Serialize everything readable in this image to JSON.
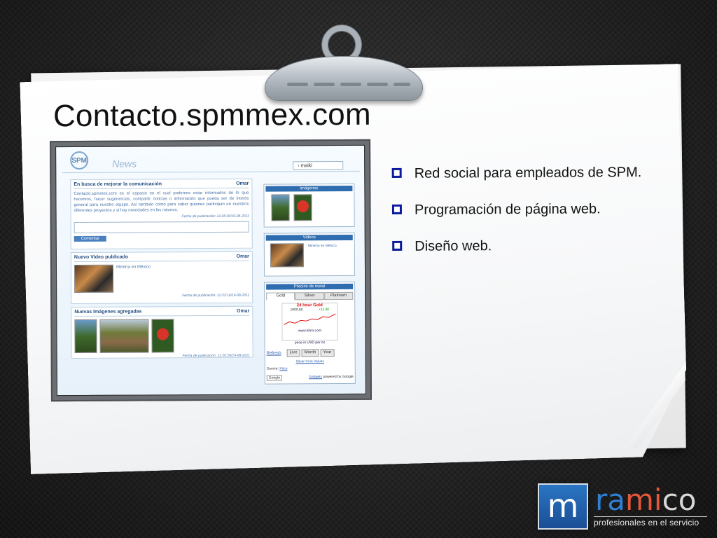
{
  "slide": {
    "title": "Contacto.spmmex.com"
  },
  "bullets": [
    "Red social para empleados de SPM.",
    "Programación de página web.",
    "Diseño web."
  ],
  "screenshot": {
    "logo": "SPM",
    "section_title": "News",
    "user": "maiki",
    "posts": [
      {
        "title": "En busca de mejorar la comunicación",
        "author": "Omar",
        "body": "Contacto.spmmex.com es el espacio en el cual podemos estar informados de lo que hacemos, hacer sugerencias, compartir noticias o información que pueda ser de interés general para nuestro equipo. Así también como para saber quienes participan en nuestros diferentes proyectos y si hay novedades en los mismos.",
        "date": "Fecha de publicación: 12:28:30/19-08-2011",
        "button": "Comentar"
      },
      {
        "title": "Nuevo Video publicado",
        "author": "Omar",
        "caption": "Minería en México",
        "date": "Fecha de publicación: 12:22:16/19-08-2011"
      },
      {
        "title": "Nuevas Imágenes agregadas",
        "author": "Omar",
        "date": "Fecha de publicación: 12:20:26/19-08-2011"
      }
    ],
    "sidebar": {
      "images_title": "Imágenes",
      "videos_title": "Videos",
      "video_caption": "Minería en México",
      "metals_title": "Precios de metal",
      "tabs": [
        "Gold",
        "Silver",
        "Platinum"
      ],
      "chart_title": "24 hour Gold",
      "chart_price": "1909.60",
      "chart_change": "+11.40",
      "chart_site": "www.kitco.com",
      "chart_unit": "price in USD per oz",
      "refresh": "Refresh",
      "range_buttons": [
        "Live",
        "Month",
        "Year"
      ],
      "coin_link": "Silver Coin Values",
      "source_label": "Source:",
      "source_value": "Kitco",
      "gadgets": "Gadgets",
      "powered": "powered by Google",
      "google": "Google"
    }
  },
  "brand": {
    "mark": "m",
    "name_part1": "ra",
    "name_part2": "mi",
    "name_part3": "co",
    "tagline": "profesionales en el servicio"
  }
}
